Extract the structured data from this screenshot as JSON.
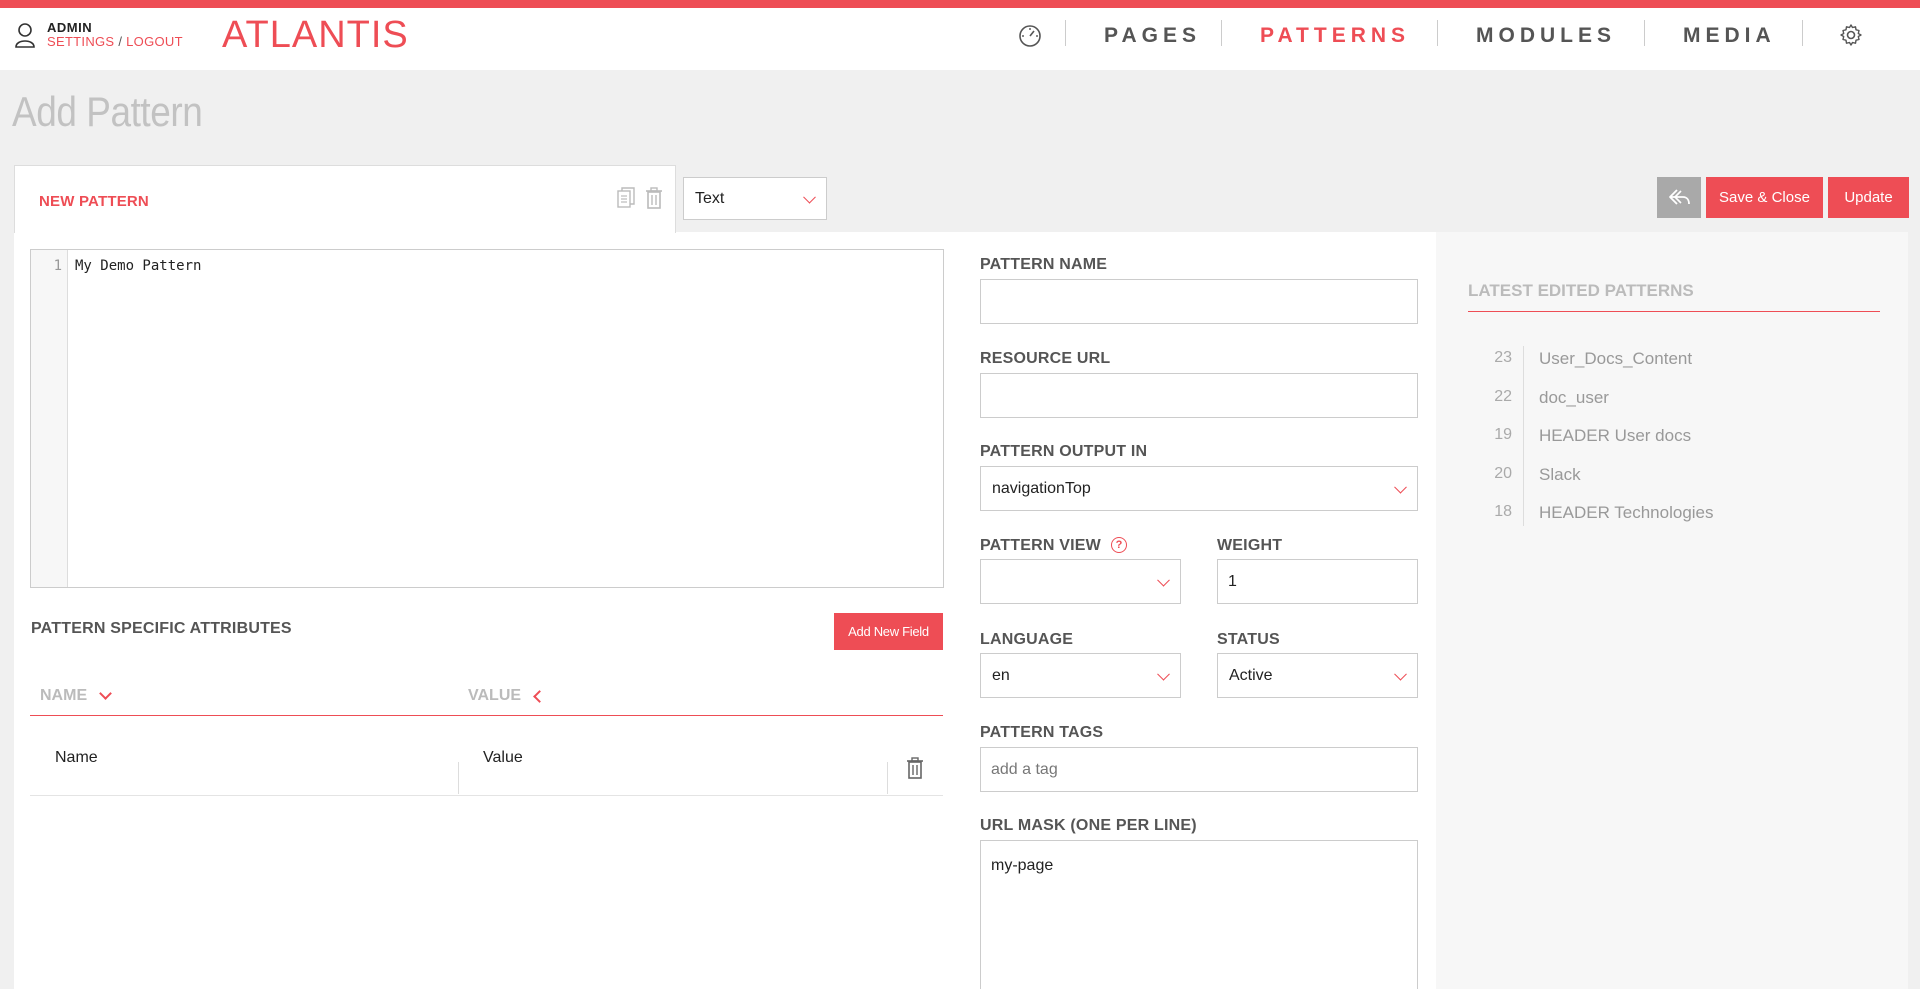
{
  "colors": {
    "accent": "#ee4d55",
    "muted": "#a9a9a9"
  },
  "header": {
    "admin_name": "ADMIN",
    "settings_link": "SETTINGS",
    "link_sep": " / ",
    "logout_link": "LOGOUT",
    "logo": "ATLANTIS",
    "nav": [
      {
        "label": "PAGES"
      },
      {
        "label": "PATTERNS",
        "active": true
      },
      {
        "label": "MODULES"
      },
      {
        "label": "MEDIA"
      }
    ],
    "icons": {
      "dashboard": "dashboard-icon",
      "settings": "gear-icon",
      "user": "user-icon"
    }
  },
  "page": {
    "title": "Add Pattern"
  },
  "tab": {
    "label": "NEW PATTERN",
    "icons": [
      "copy-icon",
      "trash-icon"
    ]
  },
  "type_select": {
    "value": "Text"
  },
  "actions": {
    "undo_icon": "undo-icon",
    "save_close": "Save & Close",
    "update": "Update"
  },
  "editor": {
    "line_number": "1",
    "content": "My Demo Pattern"
  },
  "attributes": {
    "title": "PATTERN SPECIFIC ATTRIBUTES",
    "add_button": "Add New Field",
    "columns": [
      "NAME",
      "VALUE"
    ],
    "row": {
      "name": "Name",
      "value": "Value"
    }
  },
  "form": {
    "pattern_name": {
      "label": "PATTERN NAME",
      "value": ""
    },
    "resource_url": {
      "label": "RESOURCE URL",
      "value": ""
    },
    "output_in": {
      "label": "PATTERN OUTPUT IN",
      "value": "navigationTop"
    },
    "view": {
      "label": "PATTERN VIEW",
      "value": "",
      "help": "?"
    },
    "weight": {
      "label": "WEIGHT",
      "value": "1"
    },
    "language": {
      "label": "LANGUAGE",
      "value": "en"
    },
    "status": {
      "label": "STATUS",
      "value": "Active"
    },
    "tags": {
      "label": "PATTERN TAGS",
      "placeholder": "add a tag"
    },
    "url_mask": {
      "label": "URL MASK (ONE PER LINE)",
      "value": "my-page"
    }
  },
  "latest": {
    "title": "LATEST EDITED PATTERNS",
    "items": [
      {
        "id": "23",
        "name": "User_Docs_Content"
      },
      {
        "id": "22",
        "name": "doc_user"
      },
      {
        "id": "19",
        "name": "HEADER User docs"
      },
      {
        "id": "20",
        "name": "Slack"
      },
      {
        "id": "18",
        "name": "HEADER Technologies"
      }
    ]
  }
}
